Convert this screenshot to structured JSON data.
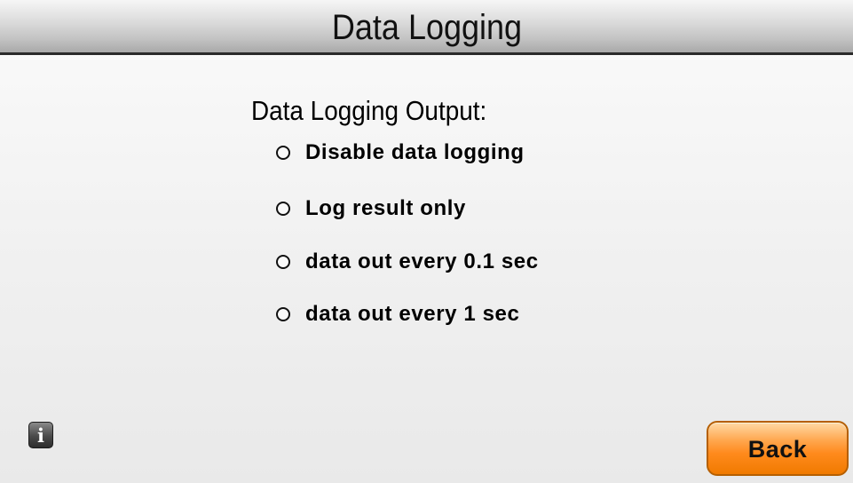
{
  "header": {
    "title": "Data Logging"
  },
  "main": {
    "section_label": "Data Logging Output:",
    "options": [
      {
        "label": "Disable data logging",
        "selected": false
      },
      {
        "label": "Log result only",
        "selected": false
      },
      {
        "label": "data out every 0.1 sec",
        "selected": false
      },
      {
        "label": "data out every 1 sec",
        "selected": false
      }
    ]
  },
  "footer": {
    "info_glyph": "i",
    "info_icon": "info-icon",
    "back_label": "Back"
  },
  "colors": {
    "accent_button": "#ff8a1c",
    "header_border": "#2a2a2a",
    "info_button": "#4a4a4a"
  }
}
